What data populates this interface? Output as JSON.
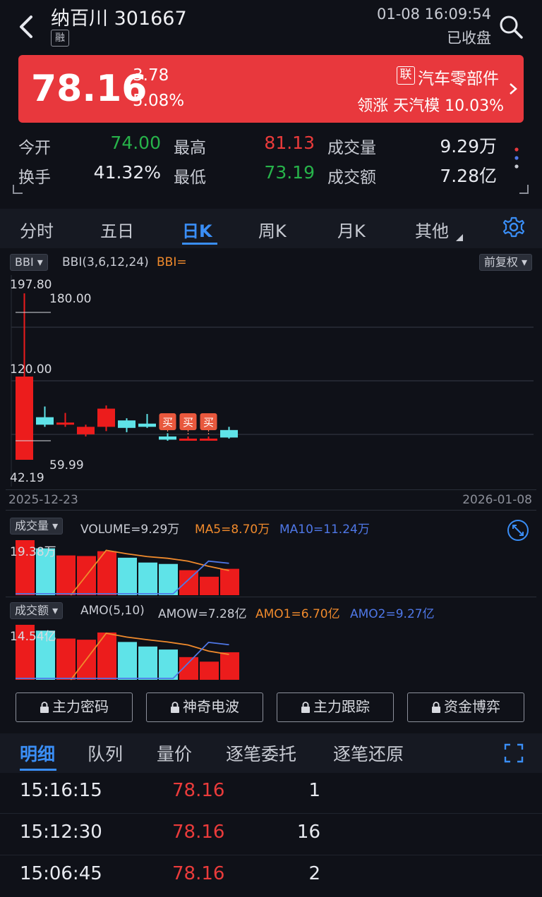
{
  "header": {
    "title": "纳百川 301667",
    "badge": "融",
    "datetime": "01-08 16:09:54",
    "status": "已收盘"
  },
  "quote": {
    "price": "78.16",
    "change": "3.78",
    "change_pct": "5.08%",
    "sector_badge": "联",
    "sector": "汽车零部件",
    "leader": "领涨 天汽模 10.03%",
    "band_color": "#e8383d"
  },
  "stats": [
    {
      "label": "今开",
      "value": "74.00",
      "color": "green"
    },
    {
      "label": "最高",
      "value": "81.13",
      "color": "red"
    },
    {
      "label": "成交量",
      "value": "9.29万",
      "color": "white"
    },
    {
      "label": "换手",
      "value": "41.32%",
      "color": "white"
    },
    {
      "label": "最低",
      "value": "73.19",
      "color": "green"
    },
    {
      "label": "成交额",
      "value": "7.28亿",
      "color": "white"
    }
  ],
  "tabs": [
    "分时",
    "五日",
    "日K",
    "周K",
    "月K",
    "其他"
  ],
  "active_tab": "日K",
  "kchart": {
    "indicator": "BBI",
    "formula": "BBI(3,6,12,24)",
    "bbi_label": "BBI=",
    "adjust": "前复权",
    "ymax": "197.80",
    "ymin": "42.19",
    "level_180": "180.00",
    "level_120": "120.00",
    "level_5999": "59.99",
    "date_start": "2025-12-23",
    "date_end": "2026-01-08",
    "buy_label": "买",
    "candles": [
      {
        "o": 120,
        "c": 42.19,
        "h": 197.8,
        "l": 42.19
      },
      {
        "o": 75,
        "c": 82,
        "h": 92,
        "l": 73
      },
      {
        "o": 77,
        "c": 75,
        "h": 86,
        "l": 73
      },
      {
        "o": 73,
        "c": 66,
        "h": 75,
        "l": 64
      },
      {
        "o": 90,
        "c": 73,
        "h": 93,
        "l": 69
      },
      {
        "o": 72,
        "c": 79,
        "h": 81,
        "l": 68
      },
      {
        "o": 73,
        "c": 76,
        "h": 85,
        "l": 72
      },
      {
        "o": 61,
        "c": 64,
        "h": 67,
        "l": 59.99
      },
      {
        "o": 62,
        "c": 60,
        "h": 64,
        "l": 60
      },
      {
        "o": 62,
        "c": 61,
        "h": 64,
        "l": 60
      },
      {
        "o": 63,
        "c": 70,
        "h": 73,
        "l": 62
      }
    ],
    "buy_signals": [
      7,
      8,
      9
    ]
  },
  "volume": {
    "chip": "成交量",
    "label": "VOLUME=9.29万",
    "ma5": "MA5=8.70万",
    "ma10": "MA10=11.24万",
    "max_label": "19.38万",
    "bars": [
      19.38,
      16.5,
      14.0,
      13.8,
      15.5,
      13.2,
      11.5,
      11.0,
      8.8,
      6.5,
      9.29
    ],
    "up": [
      true,
      false,
      true,
      true,
      true,
      false,
      false,
      false,
      true,
      true,
      true
    ],
    "ma5_line": [
      null,
      null,
      null,
      null,
      15.8,
      14.6,
      13.6,
      13.0,
      12.0,
      10.2,
      8.7
    ],
    "ma10_line": [
      null,
      null,
      null,
      null,
      null,
      null,
      null,
      null,
      null,
      12.0,
      11.24
    ]
  },
  "amount": {
    "chip": "成交额",
    "label": "AMO(5,10)",
    "amow": "AMOW=7.28亿",
    "amo1": "AMO1=6.70亿",
    "amo2": "AMO2=9.27亿",
    "max_label": "14.54亿",
    "bars": [
      14.54,
      13.0,
      10.9,
      10.6,
      12.5,
      10.0,
      8.8,
      8.0,
      6.0,
      4.8,
      7.28
    ],
    "up": [
      true,
      false,
      true,
      true,
      true,
      false,
      false,
      false,
      true,
      true,
      true
    ],
    "ma5_line": [
      null,
      null,
      null,
      null,
      12.3,
      11.3,
      10.6,
      10.0,
      9.2,
      7.6,
      6.7
    ],
    "ma10_line": [
      null,
      null,
      null,
      null,
      null,
      null,
      null,
      null,
      null,
      9.9,
      9.27
    ]
  },
  "lock_buttons": [
    "主力密码",
    "神奇电波",
    "主力跟踪",
    "资金博弈"
  ],
  "detail_tabs": [
    "明细",
    "队列",
    "量价",
    "逐笔委托",
    "逐笔还原"
  ],
  "trades": [
    {
      "time": "15:16:15",
      "price": "78.16",
      "volume": "1"
    },
    {
      "time": "15:12:30",
      "price": "78.16",
      "volume": "16"
    },
    {
      "time": "15:06:45",
      "price": "78.16",
      "volume": "2"
    }
  ]
}
